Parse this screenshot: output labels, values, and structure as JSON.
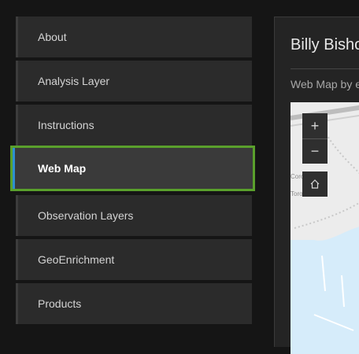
{
  "nav": {
    "items": [
      {
        "label": "About",
        "active": false
      },
      {
        "label": "Analysis Layer",
        "active": false
      },
      {
        "label": "Instructions",
        "active": false
      },
      {
        "label": "Web Map",
        "active": true
      },
      {
        "label": "Observation Layers",
        "active": false
      },
      {
        "label": "GeoEnrichment",
        "active": false
      },
      {
        "label": "Products",
        "active": false
      }
    ]
  },
  "panel": {
    "title": "Billy Bishop",
    "subtitle": "Web Map by e",
    "map": {
      "zoom_in_icon": "plus-icon",
      "zoom_out_icon": "minus-icon",
      "home_icon": "home-icon",
      "labels": [
        "Corona",
        "Toronto"
      ]
    }
  },
  "colors": {
    "active_accent": "#2e8fd1",
    "focus_outline": "#5aa02c",
    "water": "#d6ecfa"
  }
}
